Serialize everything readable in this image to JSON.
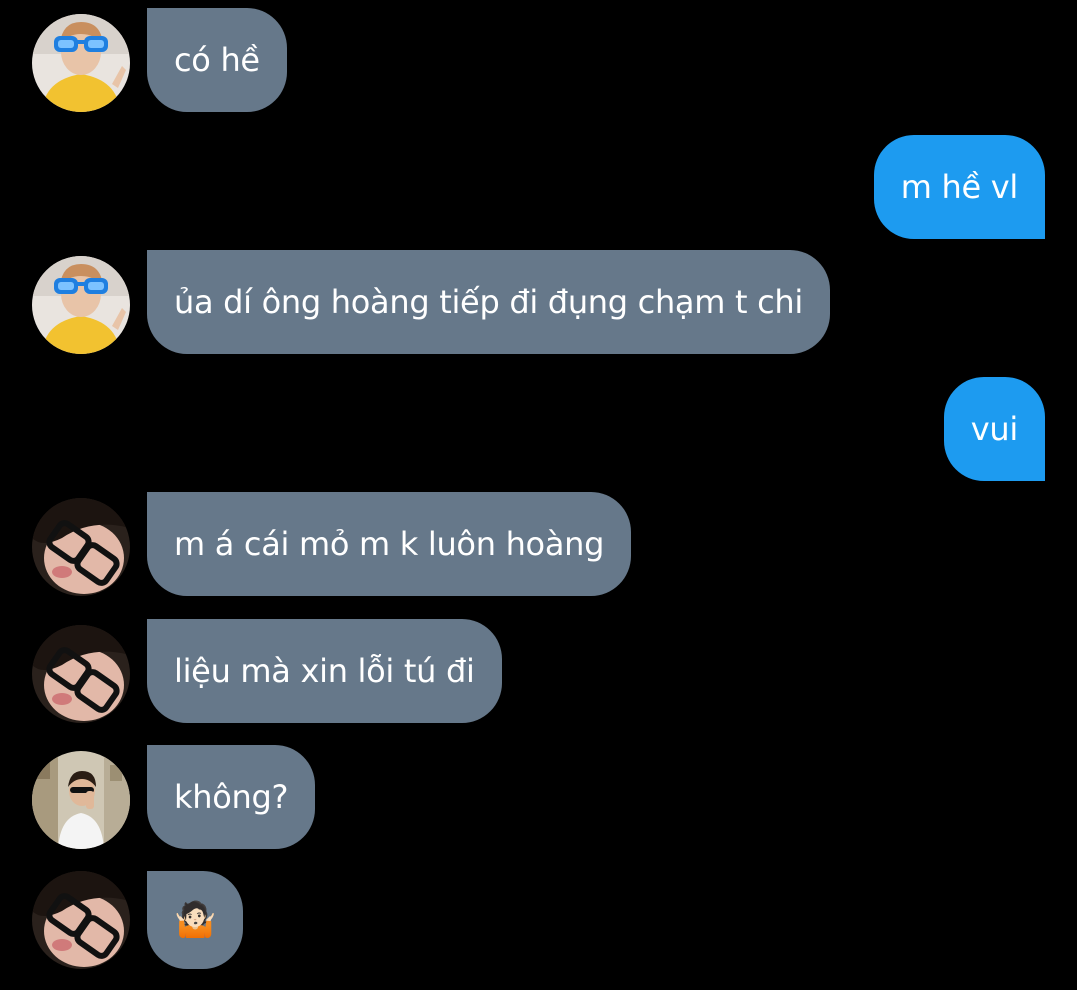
{
  "colors": {
    "background": "#000000",
    "incoming_bubble": "#66788a",
    "outgoing_bubble": "#1d9bf0",
    "text": "#ffffff"
  },
  "messages": [
    {
      "direction": "incoming",
      "sender": "avatar-blue-glasses",
      "text": "có hề"
    },
    {
      "direction": "outgoing",
      "text": "m hề vl"
    },
    {
      "direction": "incoming",
      "sender": "avatar-blue-glasses",
      "text": "ủa dí ông hoàng tiếp đi đụng chạm t chi"
    },
    {
      "direction": "outgoing",
      "text": "vui"
    },
    {
      "direction": "incoming",
      "sender": "avatar-black-glasses",
      "text": "m á cái mỏ m k luôn hoàng"
    },
    {
      "direction": "incoming",
      "sender": "avatar-black-glasses",
      "text": "liệu mà xin lỗi tú đi"
    },
    {
      "direction": "incoming",
      "sender": "avatar-street",
      "text": "không?"
    },
    {
      "direction": "incoming",
      "sender": "avatar-black-glasses",
      "text": "🤷🏻"
    }
  ]
}
